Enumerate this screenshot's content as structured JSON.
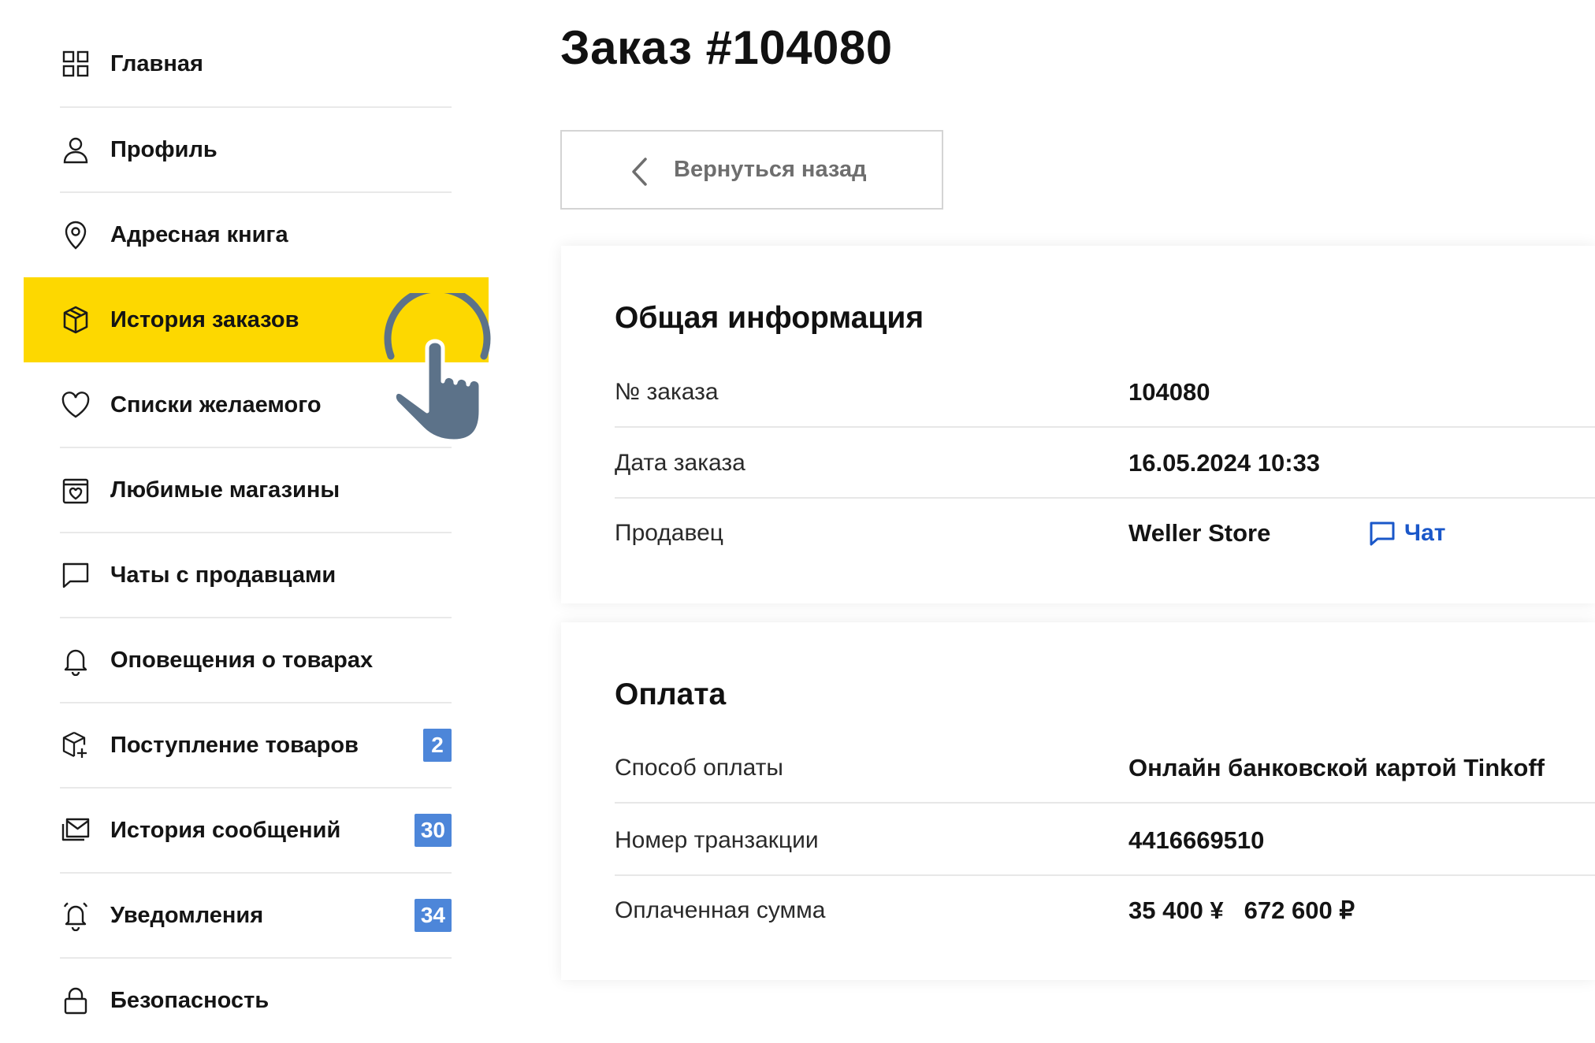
{
  "sidebar": {
    "items": [
      {
        "label": "Главная",
        "icon": "grid-icon",
        "active": false
      },
      {
        "label": "Профиль",
        "icon": "user-icon",
        "active": false
      },
      {
        "label": "Адресная книга",
        "icon": "map-pin-icon",
        "active": false
      },
      {
        "label": "История заказов",
        "icon": "box-icon",
        "active": true
      },
      {
        "label": "Списки желаемого",
        "icon": "heart-icon",
        "active": false
      },
      {
        "label": "Любимые магазины",
        "icon": "store-heart-icon",
        "active": false
      },
      {
        "label": "Чаты с продавцами",
        "icon": "chat-icon",
        "active": false
      },
      {
        "label": "Оповещения о товарах",
        "icon": "bell-icon",
        "active": false
      },
      {
        "label": "Поступление товаров",
        "icon": "package-plus-icon",
        "active": false,
        "badge": "2"
      },
      {
        "label": "История сообщений",
        "icon": "mail-history-icon",
        "active": false,
        "badge": "30"
      },
      {
        "label": "Уведомления",
        "icon": "bell-ring-icon",
        "active": false,
        "badge": "34"
      },
      {
        "label": "Безопасность",
        "icon": "lock-icon",
        "active": false
      }
    ]
  },
  "header": {
    "title": "Заказ #104080",
    "back_label": "Вернуться назад"
  },
  "general": {
    "title": "Общая информация",
    "order_no_label": "№ заказа",
    "order_no": "104080",
    "date_label": "Дата заказа",
    "date": "16.05.2024 10:33",
    "seller_label": "Продавец",
    "seller": "Weller Store",
    "chat_label": "Чат"
  },
  "payment": {
    "title": "Оплата",
    "method_label": "Способ оплаты",
    "method": "Онлайн банковской картой Tinkoff",
    "txn_label": "Номер транзакции",
    "txn": "4416669510",
    "amount_label": "Оплаченная сумма",
    "amount_cny": "35 400 ¥",
    "amount_rub": "672 600 ₽"
  },
  "colors": {
    "active_bg": "#fdd800",
    "badge_bg": "#4d86d9",
    "link": "#1a57c9"
  }
}
